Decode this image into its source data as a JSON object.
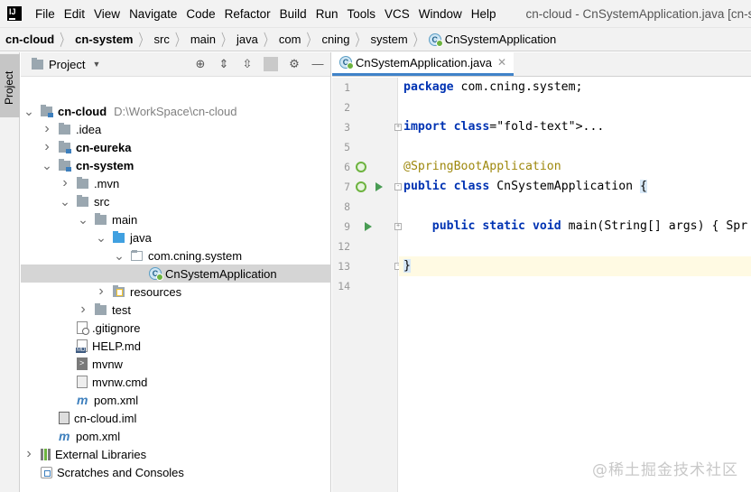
{
  "menubar": {
    "logo": "IJ",
    "items": [
      "File",
      "Edit",
      "View",
      "Navigate",
      "Code",
      "Refactor",
      "Build",
      "Run",
      "Tools",
      "VCS",
      "Window",
      "Help"
    ],
    "window_title": "cn-cloud - CnSystemApplication.java [cn-sys"
  },
  "breadcrumb": {
    "items": [
      "cn-cloud",
      "cn-system",
      "src",
      "main",
      "java",
      "com",
      "cning",
      "system",
      "CnSystemApplication"
    ]
  },
  "side_stripe": {
    "project_tab": "Project"
  },
  "project_panel": {
    "title": "Project",
    "tree": [
      {
        "label": "cn-cloud",
        "path": "D:\\WorkSpace\\cn-cloud",
        "depth": 0,
        "arrow": "down",
        "icon": "module-folder",
        "bold": true
      },
      {
        "label": ".idea",
        "depth": 1,
        "arrow": "right",
        "icon": "folder"
      },
      {
        "label": "cn-eureka",
        "depth": 1,
        "arrow": "right",
        "icon": "module-folder",
        "bold": true
      },
      {
        "label": "cn-system",
        "depth": 1,
        "arrow": "down",
        "icon": "module-folder",
        "bold": true
      },
      {
        "label": ".mvn",
        "depth": 2,
        "arrow": "right",
        "icon": "folder"
      },
      {
        "label": "src",
        "depth": 2,
        "arrow": "down",
        "icon": "folder"
      },
      {
        "label": "main",
        "depth": 3,
        "arrow": "down",
        "icon": "folder"
      },
      {
        "label": "java",
        "depth": 4,
        "arrow": "down",
        "icon": "source-folder"
      },
      {
        "label": "com.cning.system",
        "depth": 5,
        "arrow": "down",
        "icon": "package"
      },
      {
        "label": "CnSystemApplication",
        "depth": 6,
        "arrow": "none",
        "icon": "spring-class",
        "selected": true
      },
      {
        "label": "resources",
        "depth": 4,
        "arrow": "right",
        "icon": "resources-folder"
      },
      {
        "label": "test",
        "depth": 3,
        "arrow": "right",
        "icon": "folder"
      },
      {
        "label": ".gitignore",
        "depth": 2,
        "arrow": "none",
        "icon": "gitignore"
      },
      {
        "label": "HELP.md",
        "depth": 2,
        "arrow": "none",
        "icon": "markdown"
      },
      {
        "label": "mvnw",
        "depth": 2,
        "arrow": "none",
        "icon": "shell"
      },
      {
        "label": "mvnw.cmd",
        "depth": 2,
        "arrow": "none",
        "icon": "cmd"
      },
      {
        "label": "pom.xml",
        "depth": 2,
        "arrow": "none",
        "icon": "maven"
      },
      {
        "label": "cn-cloud.iml",
        "depth": 1,
        "arrow": "none",
        "icon": "iml"
      },
      {
        "label": "pom.xml",
        "depth": 1,
        "arrow": "none",
        "icon": "maven"
      },
      {
        "label": "External Libraries",
        "depth": 0,
        "arrow": "right",
        "icon": "libraries"
      },
      {
        "label": "Scratches and Consoles",
        "depth": 0,
        "arrow": "none",
        "icon": "scratches"
      }
    ]
  },
  "editor": {
    "tab_label": "CnSystemApplication.java",
    "lines": [
      {
        "n": "1",
        "code": "package com.cning.system;"
      },
      {
        "n": "2",
        "code": ""
      },
      {
        "n": "3",
        "code": "import ..."
      },
      {
        "n": "5",
        "code": ""
      },
      {
        "n": "6",
        "code": "@SpringBootApplication"
      },
      {
        "n": "7",
        "code": "public class CnSystemApplication {"
      },
      {
        "n": "8",
        "code": ""
      },
      {
        "n": "9",
        "code": "    public static void main(String[] args) { Spr"
      },
      {
        "n": "12",
        "code": ""
      },
      {
        "n": "13",
        "code": "}"
      },
      {
        "n": "14",
        "code": ""
      }
    ]
  },
  "watermark": "@稀土掘金技术社区",
  "colors": {
    "keyword": "#0033b3",
    "annotation": "#9e880d",
    "run_icon": "#499c54",
    "selection": "#d5d5d5",
    "current_line": "#fffae3"
  }
}
